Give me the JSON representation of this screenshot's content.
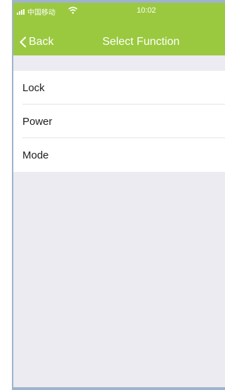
{
  "status_bar": {
    "carrier": "中国移动",
    "time": "10:02"
  },
  "nav": {
    "back_label": "Back",
    "title": "Select Function"
  },
  "functions": [
    {
      "label": "Lock"
    },
    {
      "label": "Power"
    },
    {
      "label": "Mode"
    }
  ],
  "colors": {
    "header": "#9ac93f",
    "background": "#ebebf1",
    "frame_border": "#9fb3cc"
  },
  "icons": {
    "signal": "signal-bars-icon",
    "wifi": "wifi-icon",
    "back": "chevron-left-icon"
  }
}
